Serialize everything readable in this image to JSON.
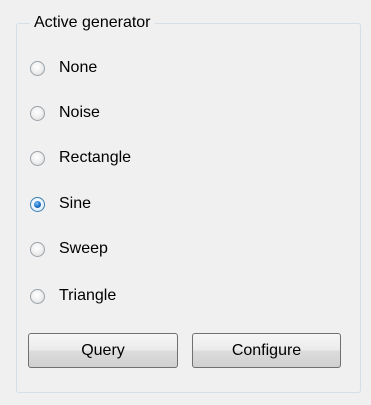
{
  "group": {
    "title": "Active generator",
    "options": [
      {
        "label": "None",
        "checked": false
      },
      {
        "label": "Noise",
        "checked": false
      },
      {
        "label": "Rectangle",
        "checked": false
      },
      {
        "label": "Sine",
        "checked": true
      },
      {
        "label": "Sweep",
        "checked": false
      },
      {
        "label": "Triangle",
        "checked": false
      }
    ]
  },
  "buttons": {
    "query_label": "Query",
    "configure_label": "Configure"
  }
}
